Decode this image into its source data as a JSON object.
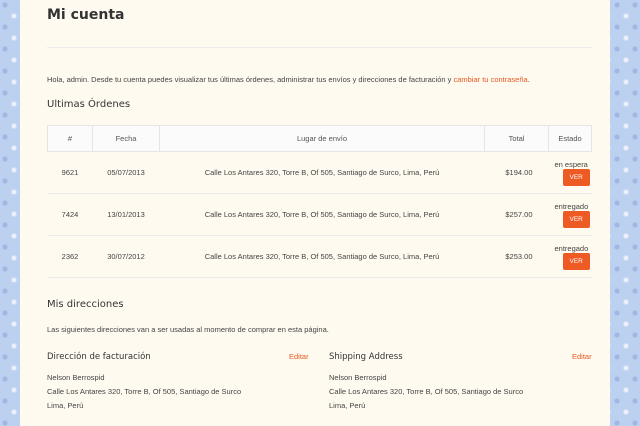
{
  "page_title": "Mi cuenta",
  "intro": {
    "text": "Hola, admin. Desde tu cuenta puedes visualizar tus últimas órdenes, administrar tus envíos y direcciones de facturación y ",
    "link": "cambiar tu contraseña",
    "end": "."
  },
  "orders": {
    "heading": "Ultimas Órdenes",
    "columns": [
      "#",
      "Fecha",
      "Lugar de envío",
      "Total",
      "Estado"
    ],
    "rows": [
      {
        "id": "9621",
        "date": "05/07/2013",
        "address": "Calle Los Antares 320, Torre B, Of 505, Santiago de Surco, Lima, Perú",
        "total": "$194.00",
        "status": "en espera",
        "action": "VER"
      },
      {
        "id": "7424",
        "date": "13/01/2013",
        "address": "Calle Los Antares 320, Torre B, Of 505, Santiago de Surco, Lima, Perú",
        "total": "$257.00",
        "status": "entregado",
        "action": "VER"
      },
      {
        "id": "2362",
        "date": "30/07/2012",
        "address": "Calle Los Antares 320, Torre B, Of 505, Santiago de Surco, Lima, Perú",
        "total": "$253.00",
        "status": "entregado",
        "action": "VER"
      }
    ]
  },
  "addresses": {
    "heading": "Mis direcciones",
    "subtitle": "Las siguientes direcciones van a ser usadas al momento de comprar en esta página.",
    "billing": {
      "title": "Dirección de facturación",
      "edit": "Editar",
      "lines": [
        "Nelson Berrospid",
        "Calle Los Antares 320, Torre B, Of 505, Santiago de Surco",
        "Lima, Perú"
      ]
    },
    "shipping": {
      "title": "Shipping Address",
      "edit": "Editar",
      "lines": [
        "Nelson Berrospid",
        "Calle Los Antares 320, Torre B, Of 505, Santiago de Surco",
        "Lima, Perú"
      ]
    }
  },
  "colors": {
    "accent": "#ee5a24",
    "panel": "#fffaf0",
    "background": "#bcd0ef"
  }
}
